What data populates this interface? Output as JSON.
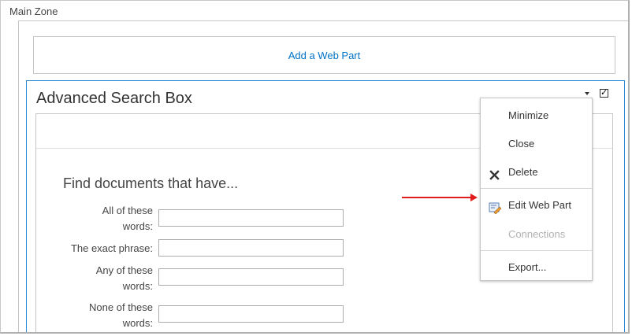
{
  "zone": {
    "title": "Main Zone",
    "add_webpart_label": "Add a Web Part"
  },
  "webpart": {
    "title": "Advanced Search Box",
    "checkbox_mark": "✓"
  },
  "search": {
    "heading": "Find documents that have...",
    "fields": [
      {
        "label_line1": "All of these",
        "label_line2": "words:",
        "value": ""
      },
      {
        "label_line1": "The exact phrase:",
        "label_line2": "",
        "value": ""
      },
      {
        "label_line1": "Any of these",
        "label_line2": "words:",
        "value": ""
      },
      {
        "label_line1": "None of these",
        "label_line2": "words:",
        "value": ""
      }
    ]
  },
  "menu": {
    "items": [
      {
        "label": "Minimize",
        "icon": "",
        "disabled": false
      },
      {
        "label": "Close",
        "icon": "",
        "disabled": false
      },
      {
        "label": "Delete",
        "icon": "delete-x-icon",
        "disabled": false
      },
      {
        "label": "Edit Web Part",
        "icon": "edit-webpart-icon",
        "disabled": false
      },
      {
        "label": "Connections",
        "icon": "",
        "disabled": true
      },
      {
        "label": "Export...",
        "icon": "",
        "disabled": false
      }
    ]
  },
  "colors": {
    "accent": "#0072c6",
    "border_active": "#2b88d8",
    "annotation_arrow": "#e21c1c",
    "disabled_text": "#b1b1b1"
  }
}
